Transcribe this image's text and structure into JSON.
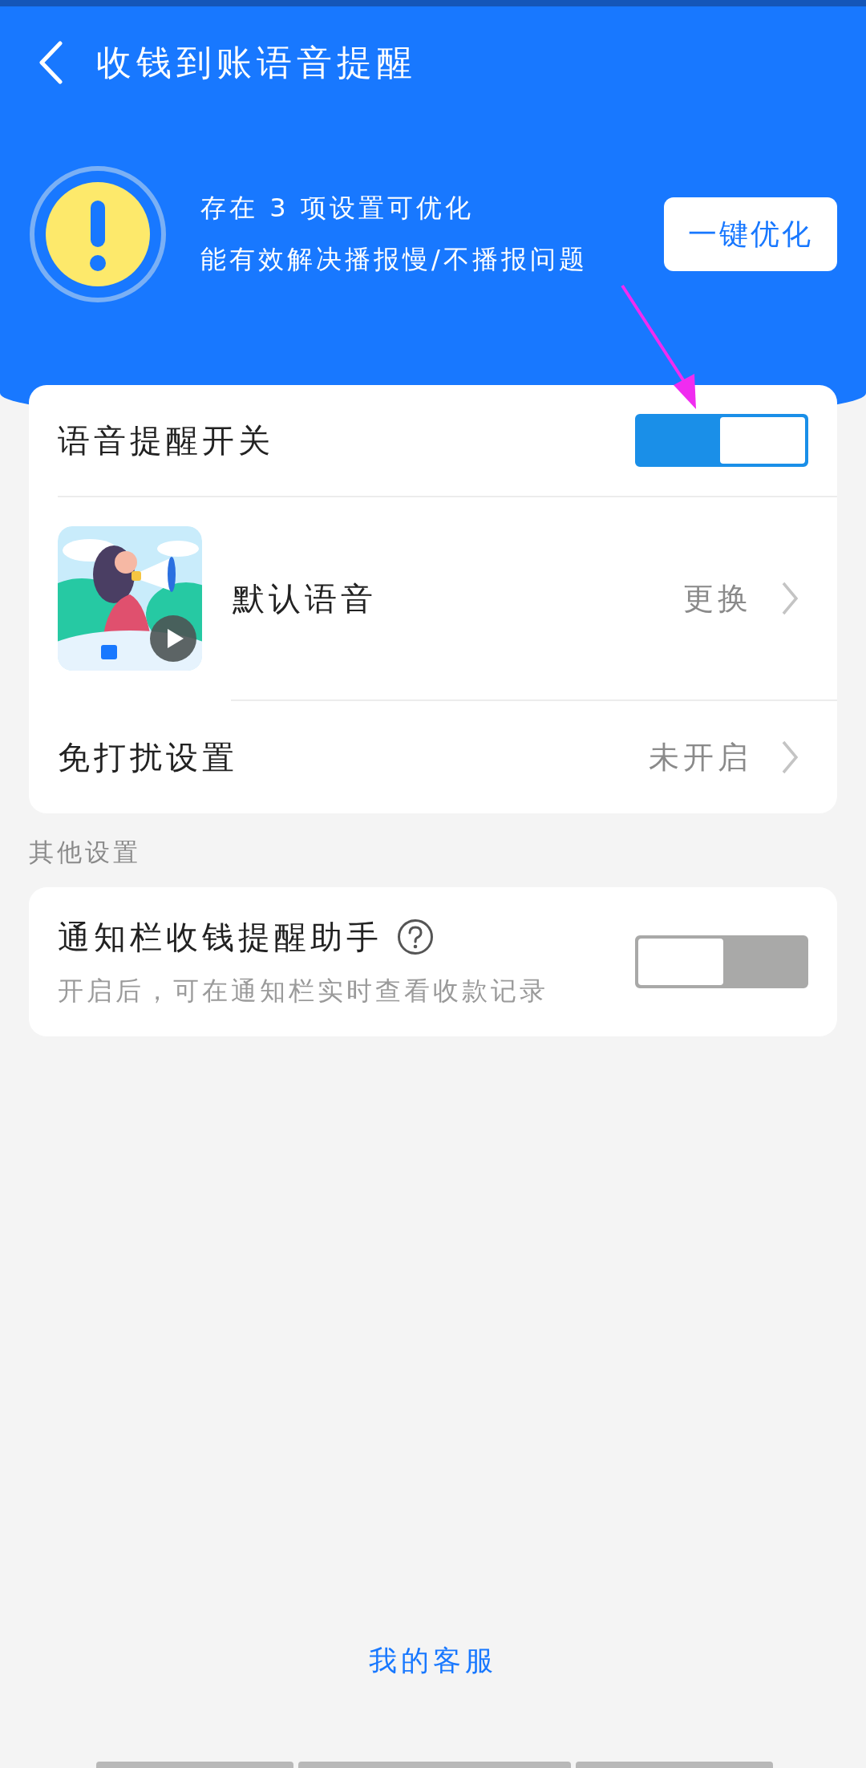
{
  "header": {
    "title": "收钱到账语音提醒"
  },
  "notice": {
    "lines": [
      "存在 3 项设置可优化",
      "能有效解决播报慢/不播报问题"
    ],
    "button": "一键优化"
  },
  "settings": [
    {
      "kind": "toggle",
      "label": "语音提醒开关",
      "on": true
    },
    {
      "kind": "voice",
      "label": "默认语音",
      "value": "更换"
    },
    {
      "kind": "link",
      "label": "免打扰设置",
      "value": "未开启"
    }
  ],
  "other": {
    "heading": "其他设置",
    "items": [
      {
        "kind": "toggle",
        "label": "通知栏收钱提醒助手",
        "hint": "开启后，可在通知栏实时查看收款记录",
        "on": false,
        "help": true
      }
    ]
  },
  "footer_link": "我的客服"
}
